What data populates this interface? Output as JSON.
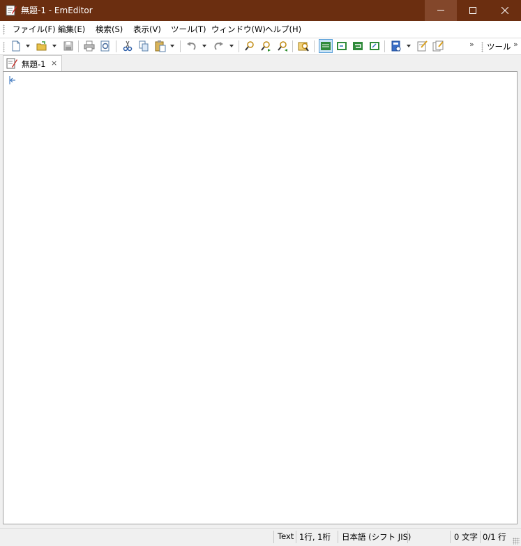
{
  "window": {
    "title": "無題-1 - EmEditor",
    "colors": {
      "titlebar": "#6b2e10",
      "accent": "#5aa0d8"
    }
  },
  "menu": {
    "items": [
      "ファイル(F)",
      "編集(E)",
      "検索(S)",
      "表示(V)",
      "ツール(T)",
      "ウィンドウ(W)",
      "ヘルプ(H)"
    ]
  },
  "toolbar": {
    "icons": [
      "new-file-icon",
      "open-file-icon",
      "save-icon",
      "print-icon",
      "print-preview-icon",
      "cut-icon",
      "copy-icon",
      "paste-icon",
      "undo-icon",
      "redo-icon",
      "find-icon",
      "find-next-icon",
      "find-previous-icon",
      "find-in-files-icon",
      "wrap-none-icon",
      "wrap-window-icon",
      "wrap-by-chars-icon",
      "wrap-page-icon",
      "bookmark-icon",
      "macro-icon",
      "macro-run-icon"
    ],
    "tools_label": "ツール"
  },
  "tabs": [
    {
      "label": "無題-1",
      "close": "×"
    }
  ],
  "editor": {
    "content": ""
  },
  "status": {
    "mode": "Text",
    "position": "1行, 1桁",
    "encoding": "日本語 (シフト JIS)",
    "chars": "0 文字",
    "lines": "0/1 行"
  }
}
